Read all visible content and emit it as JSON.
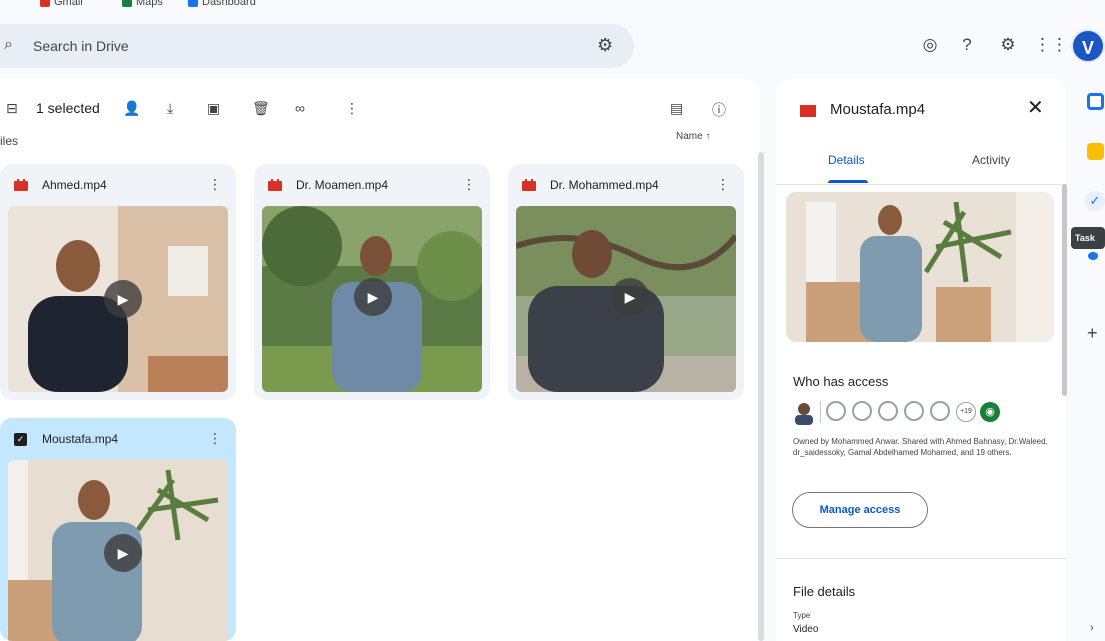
{
  "bookmarks": [
    {
      "label": "Gmail",
      "color": "#d93025"
    },
    {
      "label": "Maps",
      "color": "#188038"
    },
    {
      "label": "Dashboard",
      "color": "#1a73e8"
    }
  ],
  "search": {
    "placeholder": "Search in Drive"
  },
  "header": {
    "avatar_letter": "V"
  },
  "toolbar": {
    "selected_label": "1 selected"
  },
  "files": {
    "heading": "iles",
    "sort_label": "Name ↑"
  },
  "cards": [
    {
      "name": "Ahmed.mp4"
    },
    {
      "name": "Dr. Moamen.mp4"
    },
    {
      "name": "Dr. Mohammed.mp4"
    },
    {
      "name": "Moustafa.mp4"
    }
  ],
  "panel": {
    "title": "Moustafa.mp4",
    "tabs": [
      "Details",
      "Activity"
    ],
    "who_has_access": "Who has access",
    "more_count": "+19",
    "owned_text": "Owned by Mohammed Anwar. Shared with Ahmed Bahnasy, Dr.Waleed, dr_saidessoky, Gamal Abdelhamed Mohamed, and 19 others.",
    "manage_access": "Manage access",
    "file_details": "File details",
    "type_label": "Type",
    "type_value": "Video"
  },
  "tooltip": {
    "text": "Task"
  },
  "colors": {
    "accent": "#0b57d0",
    "video_red": "#d93025",
    "selected_bg": "#c2e7ff"
  }
}
